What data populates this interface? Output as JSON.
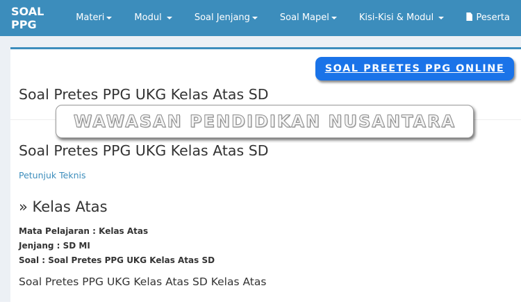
{
  "navbar": {
    "brand": "SOAL PPG",
    "items": [
      {
        "label": "Materi"
      },
      {
        "label": "Modul"
      },
      {
        "label": "Soal Jenjang"
      },
      {
        "label": "Soal Mapel"
      },
      {
        "label": "Kisi-Kisi & Modul"
      },
      {
        "label": "Peserta"
      }
    ],
    "colors": {
      "background": "#3c8dbc",
      "text": "#ffffff"
    }
  },
  "banners": {
    "online": "SOAL PREETES PPG ONLINE",
    "watermark": "WAWASAN PENDIDIKAN NUSANTARA"
  },
  "page": {
    "header": "Soal Pretes PPG UKG Kelas Atas SD",
    "article_title": "Soal Pretes PPG UKG Kelas Atas SD",
    "link_petunjuk": "Petunjuk Teknis",
    "section_heading": "» Kelas Atas",
    "meta": {
      "mata_pelajaran": "Mata Pelajaran : Kelas Atas",
      "jenjang": "Jenjang : SD MI",
      "soal": "Soal : Soal Pretes PPG UKG Kelas Atas SD"
    },
    "body_text": "Soal Pretes PPG UKG Kelas Atas SD Kelas Atas"
  },
  "icons": {
    "dropdown": "caret-down-icon",
    "peserta": "document-icon"
  },
  "colors": {
    "accent": "#3c8dbc",
    "banner_blue": "#1a73e8",
    "content_bg": "#ecf0f5",
    "text": "#333333"
  }
}
